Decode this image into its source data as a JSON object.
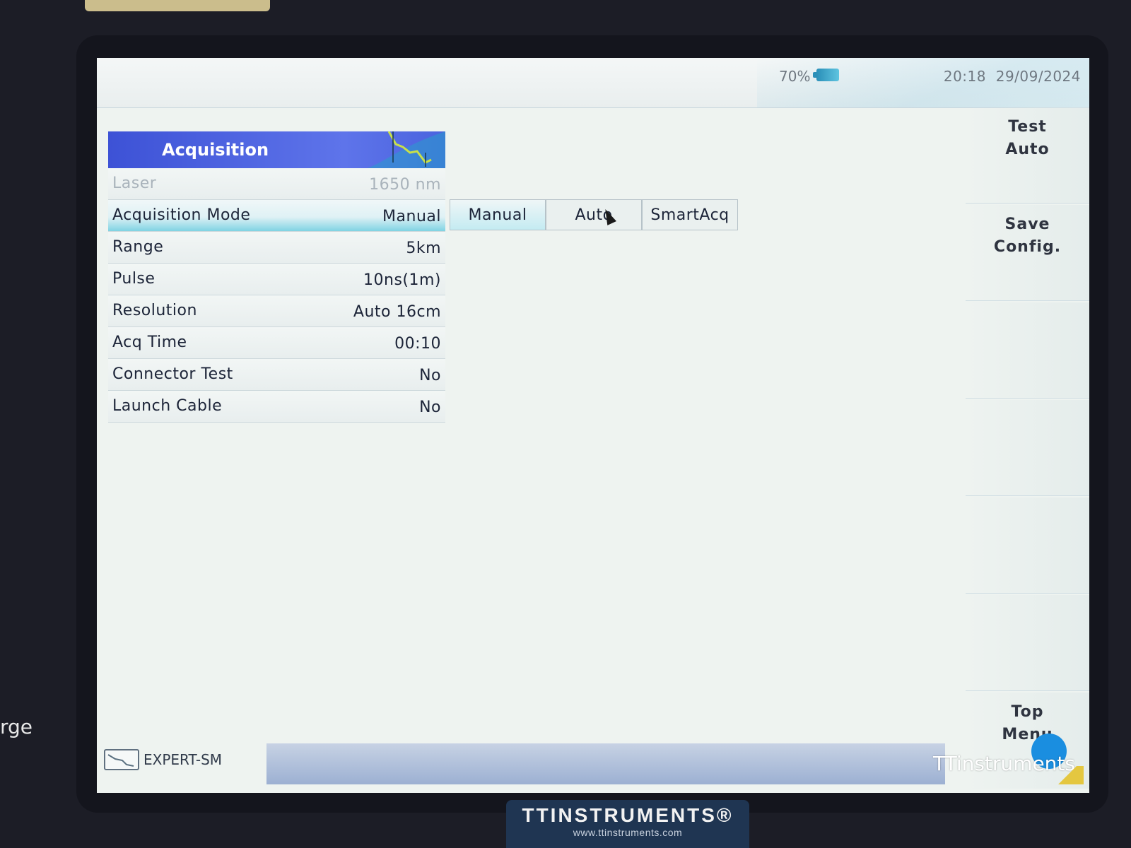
{
  "status_bar": {
    "battery": "70%",
    "time": "20:18",
    "date": "29/09/2024"
  },
  "panel": {
    "title": "Acquisition",
    "rows": [
      {
        "label": "Laser",
        "value": "1650 nm"
      },
      {
        "label": "Acquisition Mode",
        "value": "Manual"
      },
      {
        "label": "Range",
        "value": "5km"
      },
      {
        "label": "Pulse",
        "value": "10ns(1m)"
      },
      {
        "label": "Resolution",
        "value": "Auto 16cm"
      },
      {
        "label": "Acq Time",
        "value": "00:10"
      },
      {
        "label": "Connector Test",
        "value": "No"
      },
      {
        "label": "Launch Cable",
        "value": "No"
      }
    ]
  },
  "options": [
    "Manual",
    "Auto",
    "SmartAcq"
  ],
  "softkeys": {
    "test_auto": [
      "Test",
      "Auto"
    ],
    "save_config": [
      "Save",
      "Config."
    ],
    "top_menu": [
      "Top",
      "Menu"
    ]
  },
  "bottom": {
    "device": "EXPERT-SM",
    "brand_overlay": "TTinstruments"
  },
  "hardware": {
    "logo": "TTINSTRUMENTS®",
    "url": "www.ttinstruments.com",
    "side_text": "rge"
  },
  "colors": {
    "header_blue": "#3d52d6",
    "accent_cyan": "#7fd3e3",
    "circle_blue": "#1a8ee0"
  },
  "icons": [
    "battery-icon",
    "otdr-trace-icon",
    "device-icon",
    "mouse-cursor-icon"
  ]
}
